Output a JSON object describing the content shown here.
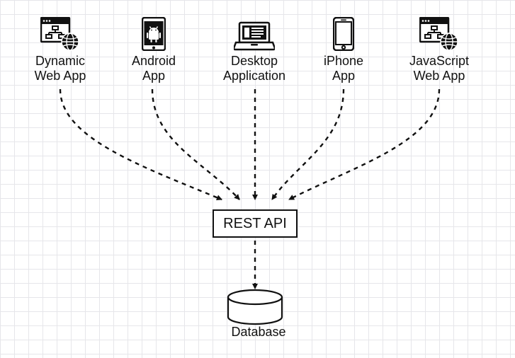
{
  "diagram": {
    "clients": [
      {
        "name": "dynamic-web-app",
        "line1": "Dynamic",
        "line2": "Web App"
      },
      {
        "name": "android-app",
        "line1": "Android",
        "line2": "App"
      },
      {
        "name": "desktop-app",
        "line1": "Desktop",
        "line2": "Application"
      },
      {
        "name": "iphone-app",
        "line1": "iPhone",
        "line2": "App"
      },
      {
        "name": "javascript-web-app",
        "line1": "JavaScript",
        "line2": "Web App"
      }
    ],
    "rest_api_label": "REST API",
    "database_label": "Database"
  }
}
